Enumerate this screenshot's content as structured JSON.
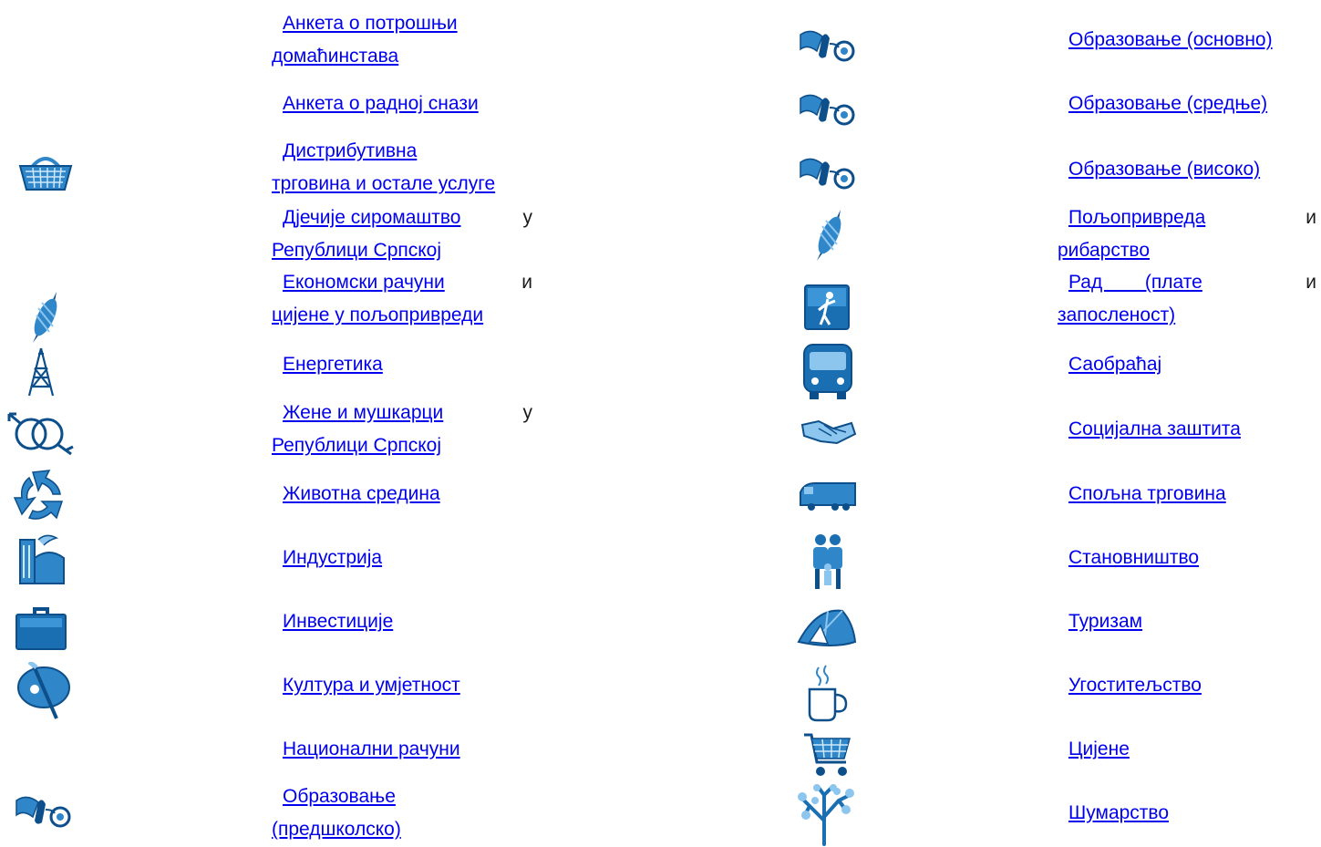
{
  "left": [
    {
      "id": "hh-budget",
      "lines": [
        "Анкета   о   потрошњи",
        "домаћинстава"
      ],
      "icon": null
    },
    {
      "id": "labour",
      "lines": [
        "Анкета о радној снази"
      ],
      "icon": null
    },
    {
      "id": "trade",
      "lines": [
        "Дистрибутивна",
        "трговина и остале услуге"
      ],
      "icon": "basket-icon"
    },
    {
      "id": "child-poverty",
      "lines": [
        "Дјечије   сиромаштво",
        "Републици Српској"
      ],
      "trail": "у",
      "icon": null
    },
    {
      "id": "econ-agri",
      "lines": [
        "Економски   рачуни",
        "цијене у пољопривреди"
      ],
      "trail": "и",
      "icon": "corn-icon"
    },
    {
      "id": "energy",
      "lines": [
        "Енергетика"
      ],
      "icon": "oil-tower-icon"
    },
    {
      "id": "gender",
      "lines": [
        "Жене   и   мушкарци",
        "Републици Српској"
      ],
      "trail": "у",
      "icon": "gender-symbols-icon"
    },
    {
      "id": "environment",
      "lines": [
        "Животна средина"
      ],
      "icon": "recycle-icon"
    },
    {
      "id": "industry",
      "lines": [
        "Индустрија"
      ],
      "icon": "factory-icon"
    },
    {
      "id": "investments",
      "lines": [
        "Инвестиције"
      ],
      "icon": "briefcase-icon"
    },
    {
      "id": "culture",
      "lines": [
        "Култура и умјетност"
      ],
      "icon": "palette-icon"
    },
    {
      "id": "national-accounts",
      "lines": [
        "Национални рачуни"
      ],
      "icon": null
    },
    {
      "id": "edu-preschool",
      "lines": [
        "Образовање",
        "(предшколско)"
      ],
      "icon": "ribbon-icon"
    }
  ],
  "right": [
    {
      "id": "edu-primary",
      "lines": [
        "Образовање (основно)"
      ],
      "icon": "ribbon-icon"
    },
    {
      "id": "edu-secondary",
      "lines": [
        "Образовање (средње)"
      ],
      "icon": "ribbon-icon"
    },
    {
      "id": "edu-higher",
      "lines": [
        "Образовање (високо)"
      ],
      "icon": "ribbon-icon"
    },
    {
      "id": "agriculture",
      "lines": [
        "Пољопривреда",
        "рибарство"
      ],
      "trail": "и",
      "icon": "corn-icon"
    },
    {
      "id": "labour-wages",
      "lines": [
        "Рад        (плате",
        "запосленост)"
      ],
      "trail": "и",
      "icon": "worker-icon"
    },
    {
      "id": "transport",
      "lines": [
        "Саобраћај"
      ],
      "icon": "bus-icon"
    },
    {
      "id": "social",
      "lines": [
        "Социјална заштита"
      ],
      "icon": "handshake-icon"
    },
    {
      "id": "foreign-trade",
      "lines": [
        "Спољна трговина"
      ],
      "icon": "truck-icon"
    },
    {
      "id": "population",
      "lines": [
        "Становништво"
      ],
      "icon": "family-icon"
    },
    {
      "id": "tourism",
      "lines": [
        "Туризам"
      ],
      "icon": "tent-icon"
    },
    {
      "id": "hospitality",
      "lines": [
        "Угоститељство"
      ],
      "icon": "coffee-cup-icon"
    },
    {
      "id": "prices",
      "lines": [
        "Цијене"
      ],
      "icon": "cart-icon"
    },
    {
      "id": "forestry",
      "lines": [
        "Шумарство"
      ],
      "icon": "tree-icon"
    }
  ],
  "colors": {
    "link": "#0000ee",
    "icon_dark": "#0d4f8b",
    "icon_mid": "#2f86c8",
    "icon_light": "#8cc6ef"
  }
}
